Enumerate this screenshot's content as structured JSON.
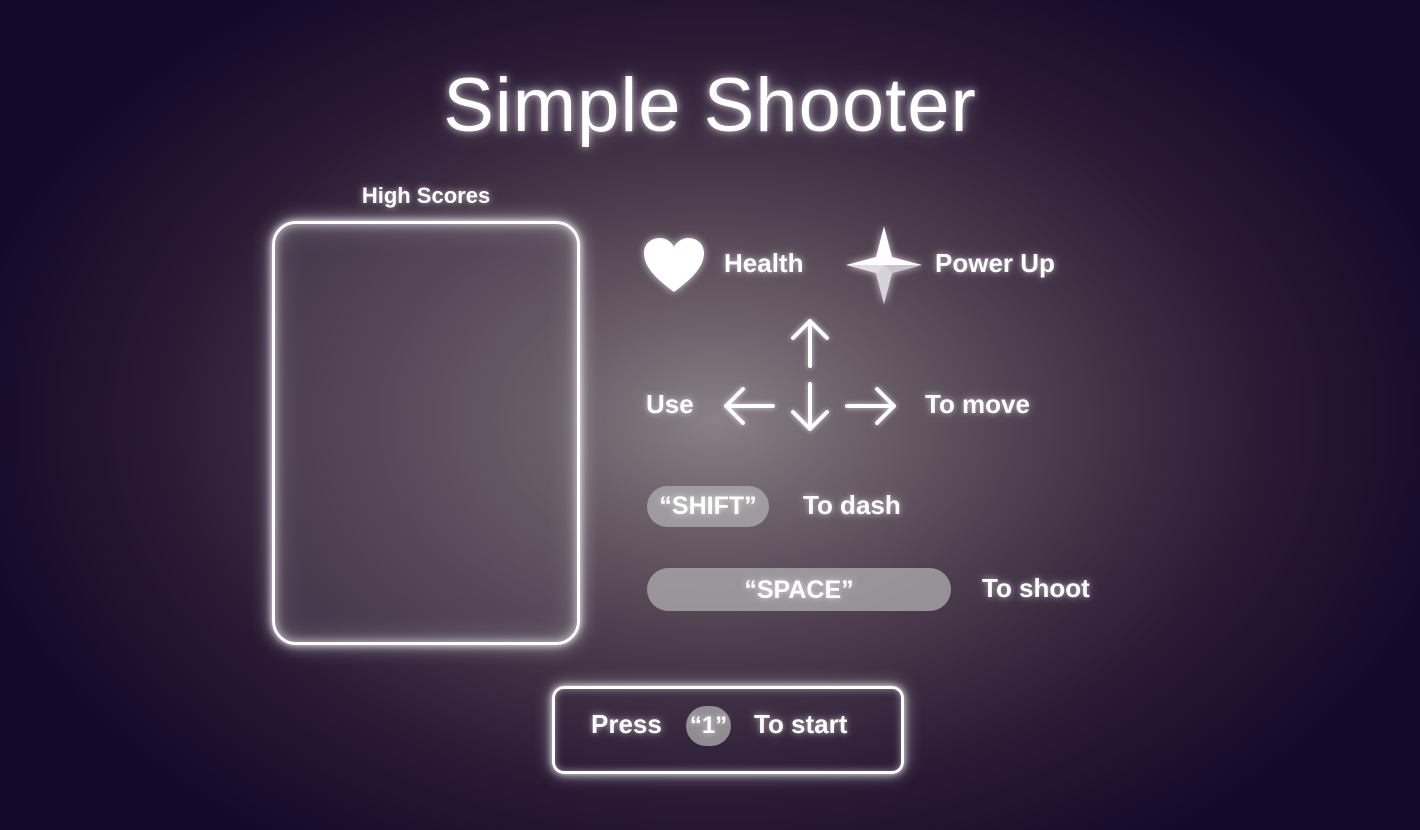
{
  "game": {
    "title": "Simple Shooter"
  },
  "high_scores": {
    "label": "High Scores",
    "entries": []
  },
  "legend": {
    "health_label": "Health",
    "health_icon": "heart-icon",
    "powerup_label": "Power Up",
    "powerup_icon": "four-point-star-icon"
  },
  "controls": {
    "move_prefix": "Use",
    "move_icons": [
      "arrow-up-icon",
      "arrow-left-icon",
      "arrow-down-icon",
      "arrow-right-icon"
    ],
    "move_suffix": "To move",
    "dash_key": "“SHIFT”",
    "dash_action": "To dash",
    "shoot_key": "“SPACE”",
    "shoot_action": "To shoot"
  },
  "start_prompt": {
    "prefix": "Press",
    "key": "“1”",
    "suffix": "To start"
  },
  "colors": {
    "glow": "#ffffff",
    "key_pill": "#afafaf",
    "background_center": "#8a8086",
    "background_edge": "#16082a"
  }
}
